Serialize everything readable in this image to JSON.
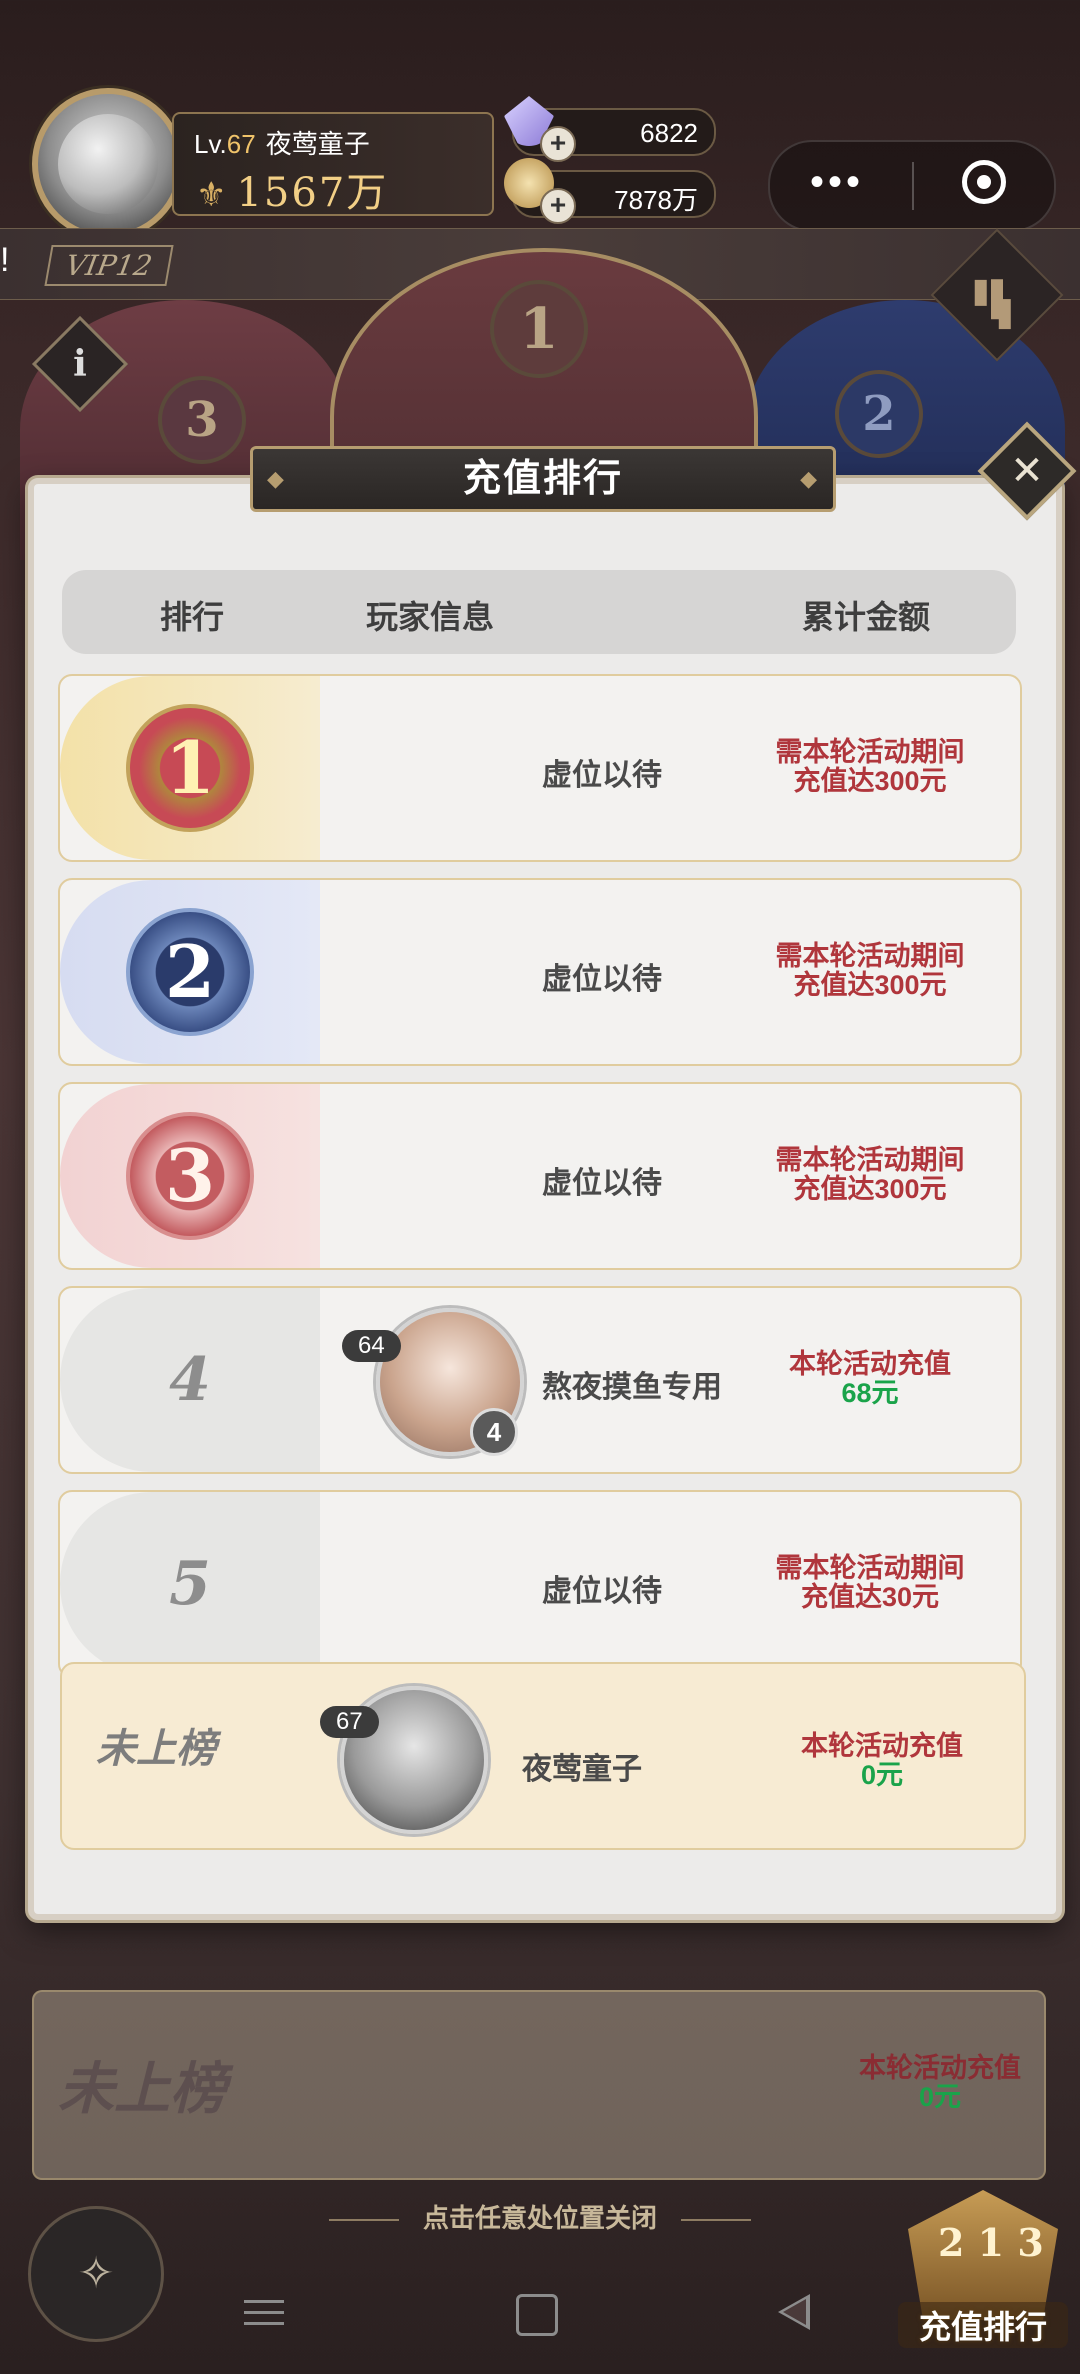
{
  "player": {
    "level_prefix": "Lv.",
    "level": "67",
    "name": "夜莺童子",
    "power": "1567万"
  },
  "resources": [
    {
      "icon": "diamond-icon",
      "value": "6822"
    },
    {
      "icon": "coin-icon",
      "value": "7878万"
    }
  ],
  "top": {
    "ticker": "!",
    "vip": "VIP12",
    "podium": [
      "1",
      "2",
      "3"
    ]
  },
  "popup": {
    "title": "充值排行",
    "headers": {
      "rank": "排行",
      "player": "玩家信息",
      "amount": "累计金额"
    },
    "rows": [
      {
        "rank": "1",
        "place": "虚位以待",
        "amount_line1": "需本轮活动期间",
        "amount_line2": "充值达300元"
      },
      {
        "rank": "2",
        "place": "虚位以待",
        "amount_line1": "需本轮活动期间",
        "amount_line2": "充值达300元"
      },
      {
        "rank": "3",
        "place": "虚位以待",
        "amount_line1": "需本轮活动期间",
        "amount_line2": "充值达300元"
      },
      {
        "rank": "4",
        "player_level": "64",
        "player_badge": "4",
        "player_name": "熬夜摸鱼专用",
        "amount_line1": "本轮活动充值",
        "amount_value": "68元"
      },
      {
        "rank": "5",
        "place": "虚位以待",
        "amount_line1": "需本轮活动期间",
        "amount_line2": "充值达30元"
      }
    ],
    "my_row": {
      "rank": "未上榜",
      "level": "67",
      "name": "夜莺童子",
      "amount_line1": "本轮活动充值",
      "amount_value": "0元"
    }
  },
  "background_card": {
    "rank": "未上榜",
    "amount_line1": "本轮活动充值",
    "amount_value": "0元"
  },
  "close_hint": "点击任意处位置关闭",
  "rank_entry": {
    "digits": "2 1 3",
    "label": "充值排行"
  },
  "colors": {
    "accent_gold": "#b69d70",
    "amount_red": "#b0363c",
    "amount_green": "#1aa34a"
  }
}
